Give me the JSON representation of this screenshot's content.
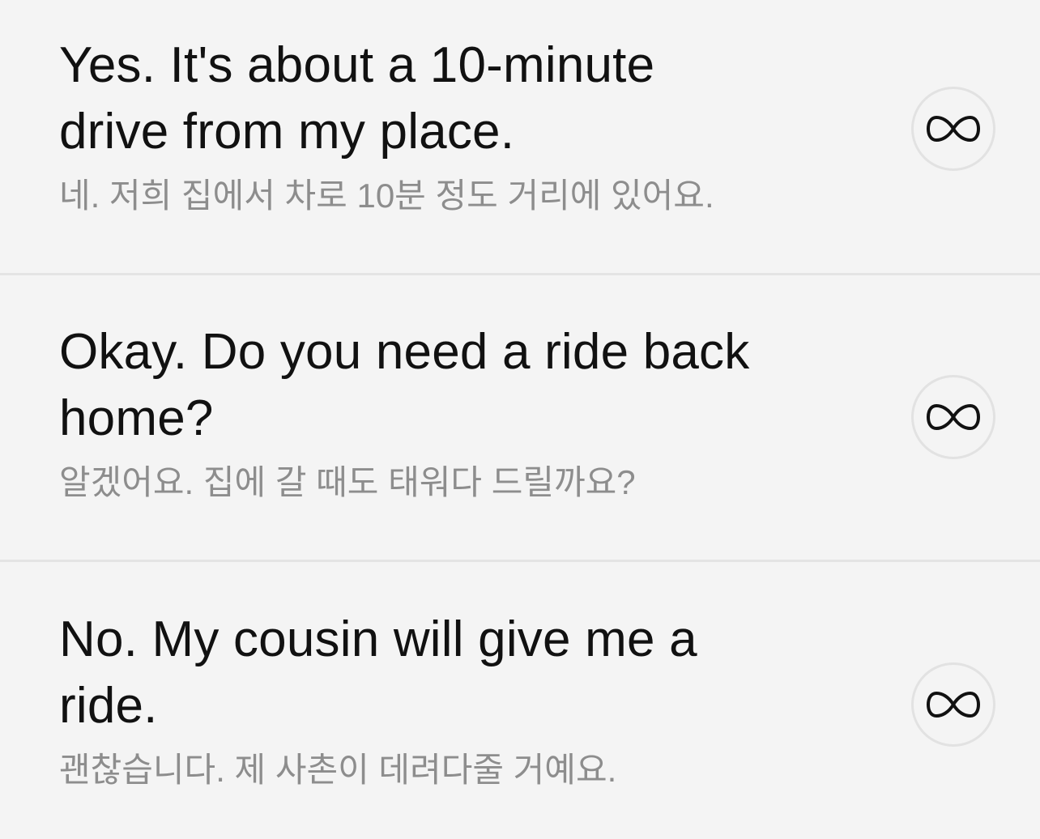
{
  "sentences": [
    {
      "english": "Yes. It's about a 10-minute drive from my place.",
      "korean": "네. 저희 집에서 차로 10분 정도 거리에 있어요.",
      "repeat_icon": "infinity-icon"
    },
    {
      "english": "Okay. Do you need a ride back home?",
      "korean": "알겠어요. 집에 갈 때도 태워다 드릴까요?",
      "repeat_icon": "infinity-icon"
    },
    {
      "english": "No. My cousin will give me a ride.",
      "korean": "괜찮습니다. 제 사촌이 데려다줄 거예요.",
      "repeat_icon": "infinity-icon"
    }
  ],
  "colors": {
    "background": "#f4f4f4",
    "divider": "#e4e4e4",
    "english_text": "#111111",
    "korean_text": "#8d8d8d"
  }
}
